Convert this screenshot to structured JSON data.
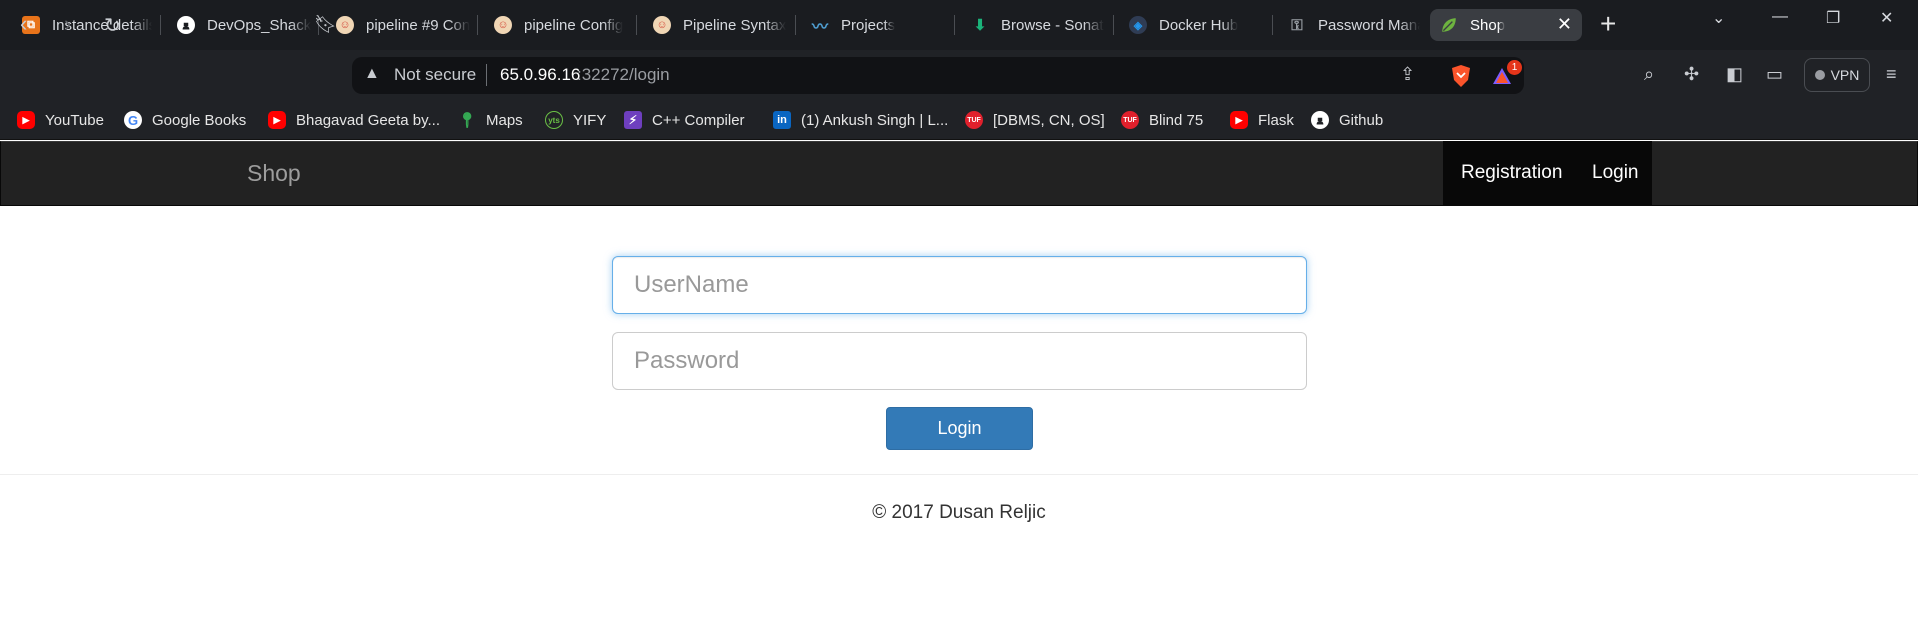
{
  "browser": {
    "tabs": [
      {
        "title": "Instance details",
        "icon": "aws-icon",
        "color": "#e8731a"
      },
      {
        "title": "DevOps_Shack",
        "icon": "github-icon",
        "color": "#ffffff"
      },
      {
        "title": "pipeline #9 Con",
        "icon": "jenkins-icon",
        "color": "#d24939"
      },
      {
        "title": "pipeline Config",
        "icon": "jenkins-icon",
        "color": "#d24939"
      },
      {
        "title": "Pipeline Syntax",
        "icon": "jenkins-icon",
        "color": "#d24939"
      },
      {
        "title": "Projects",
        "icon": "sonar-icon",
        "color": "#4e9bcd"
      },
      {
        "title": "Browse - Sonat",
        "icon": "nexus-icon",
        "color": "#1bb37a"
      },
      {
        "title": "Docker Hub",
        "icon": "docker-icon",
        "color": "#2496ed"
      },
      {
        "title": "Password Mana",
        "icon": "key-icon",
        "color": "#9aa0a6"
      },
      {
        "title": "Shop",
        "icon": "spring-leaf-icon",
        "color": "#6db33f"
      }
    ],
    "address": {
      "security": "Not secure",
      "host": "65.0.96.16",
      "rest": ":32272/login"
    },
    "brave_badge": "1",
    "vpn_label": "VPN",
    "bookmarks": [
      {
        "label": "YouTube",
        "icon": "youtube-icon"
      },
      {
        "label": "Google Books",
        "icon": "google-icon"
      },
      {
        "label": "Bhagavad Geeta by...",
        "icon": "youtube-icon"
      },
      {
        "label": "Maps",
        "icon": "maps-pin-icon"
      },
      {
        "label": "YIFY",
        "icon": "yify-icon"
      },
      {
        "label": "C++ Compiler",
        "icon": "bolt-icon"
      },
      {
        "label": "(1) Ankush Singh | L...",
        "icon": "linkedin-icon"
      },
      {
        "label": "[DBMS, CN, OS]",
        "icon": "tuf-icon"
      },
      {
        "label": "Blind 75",
        "icon": "tuf-icon"
      },
      {
        "label": "Flask",
        "icon": "youtube-icon"
      },
      {
        "label": "Github",
        "icon": "github-icon"
      }
    ]
  },
  "page": {
    "brand": "Shop",
    "nav": {
      "registration": "Registration",
      "login": "Login"
    },
    "form": {
      "username_placeholder": "UserName",
      "password_placeholder": "Password",
      "submit_label": "Login"
    },
    "footer": "© 2017 Dusan Reljic"
  }
}
